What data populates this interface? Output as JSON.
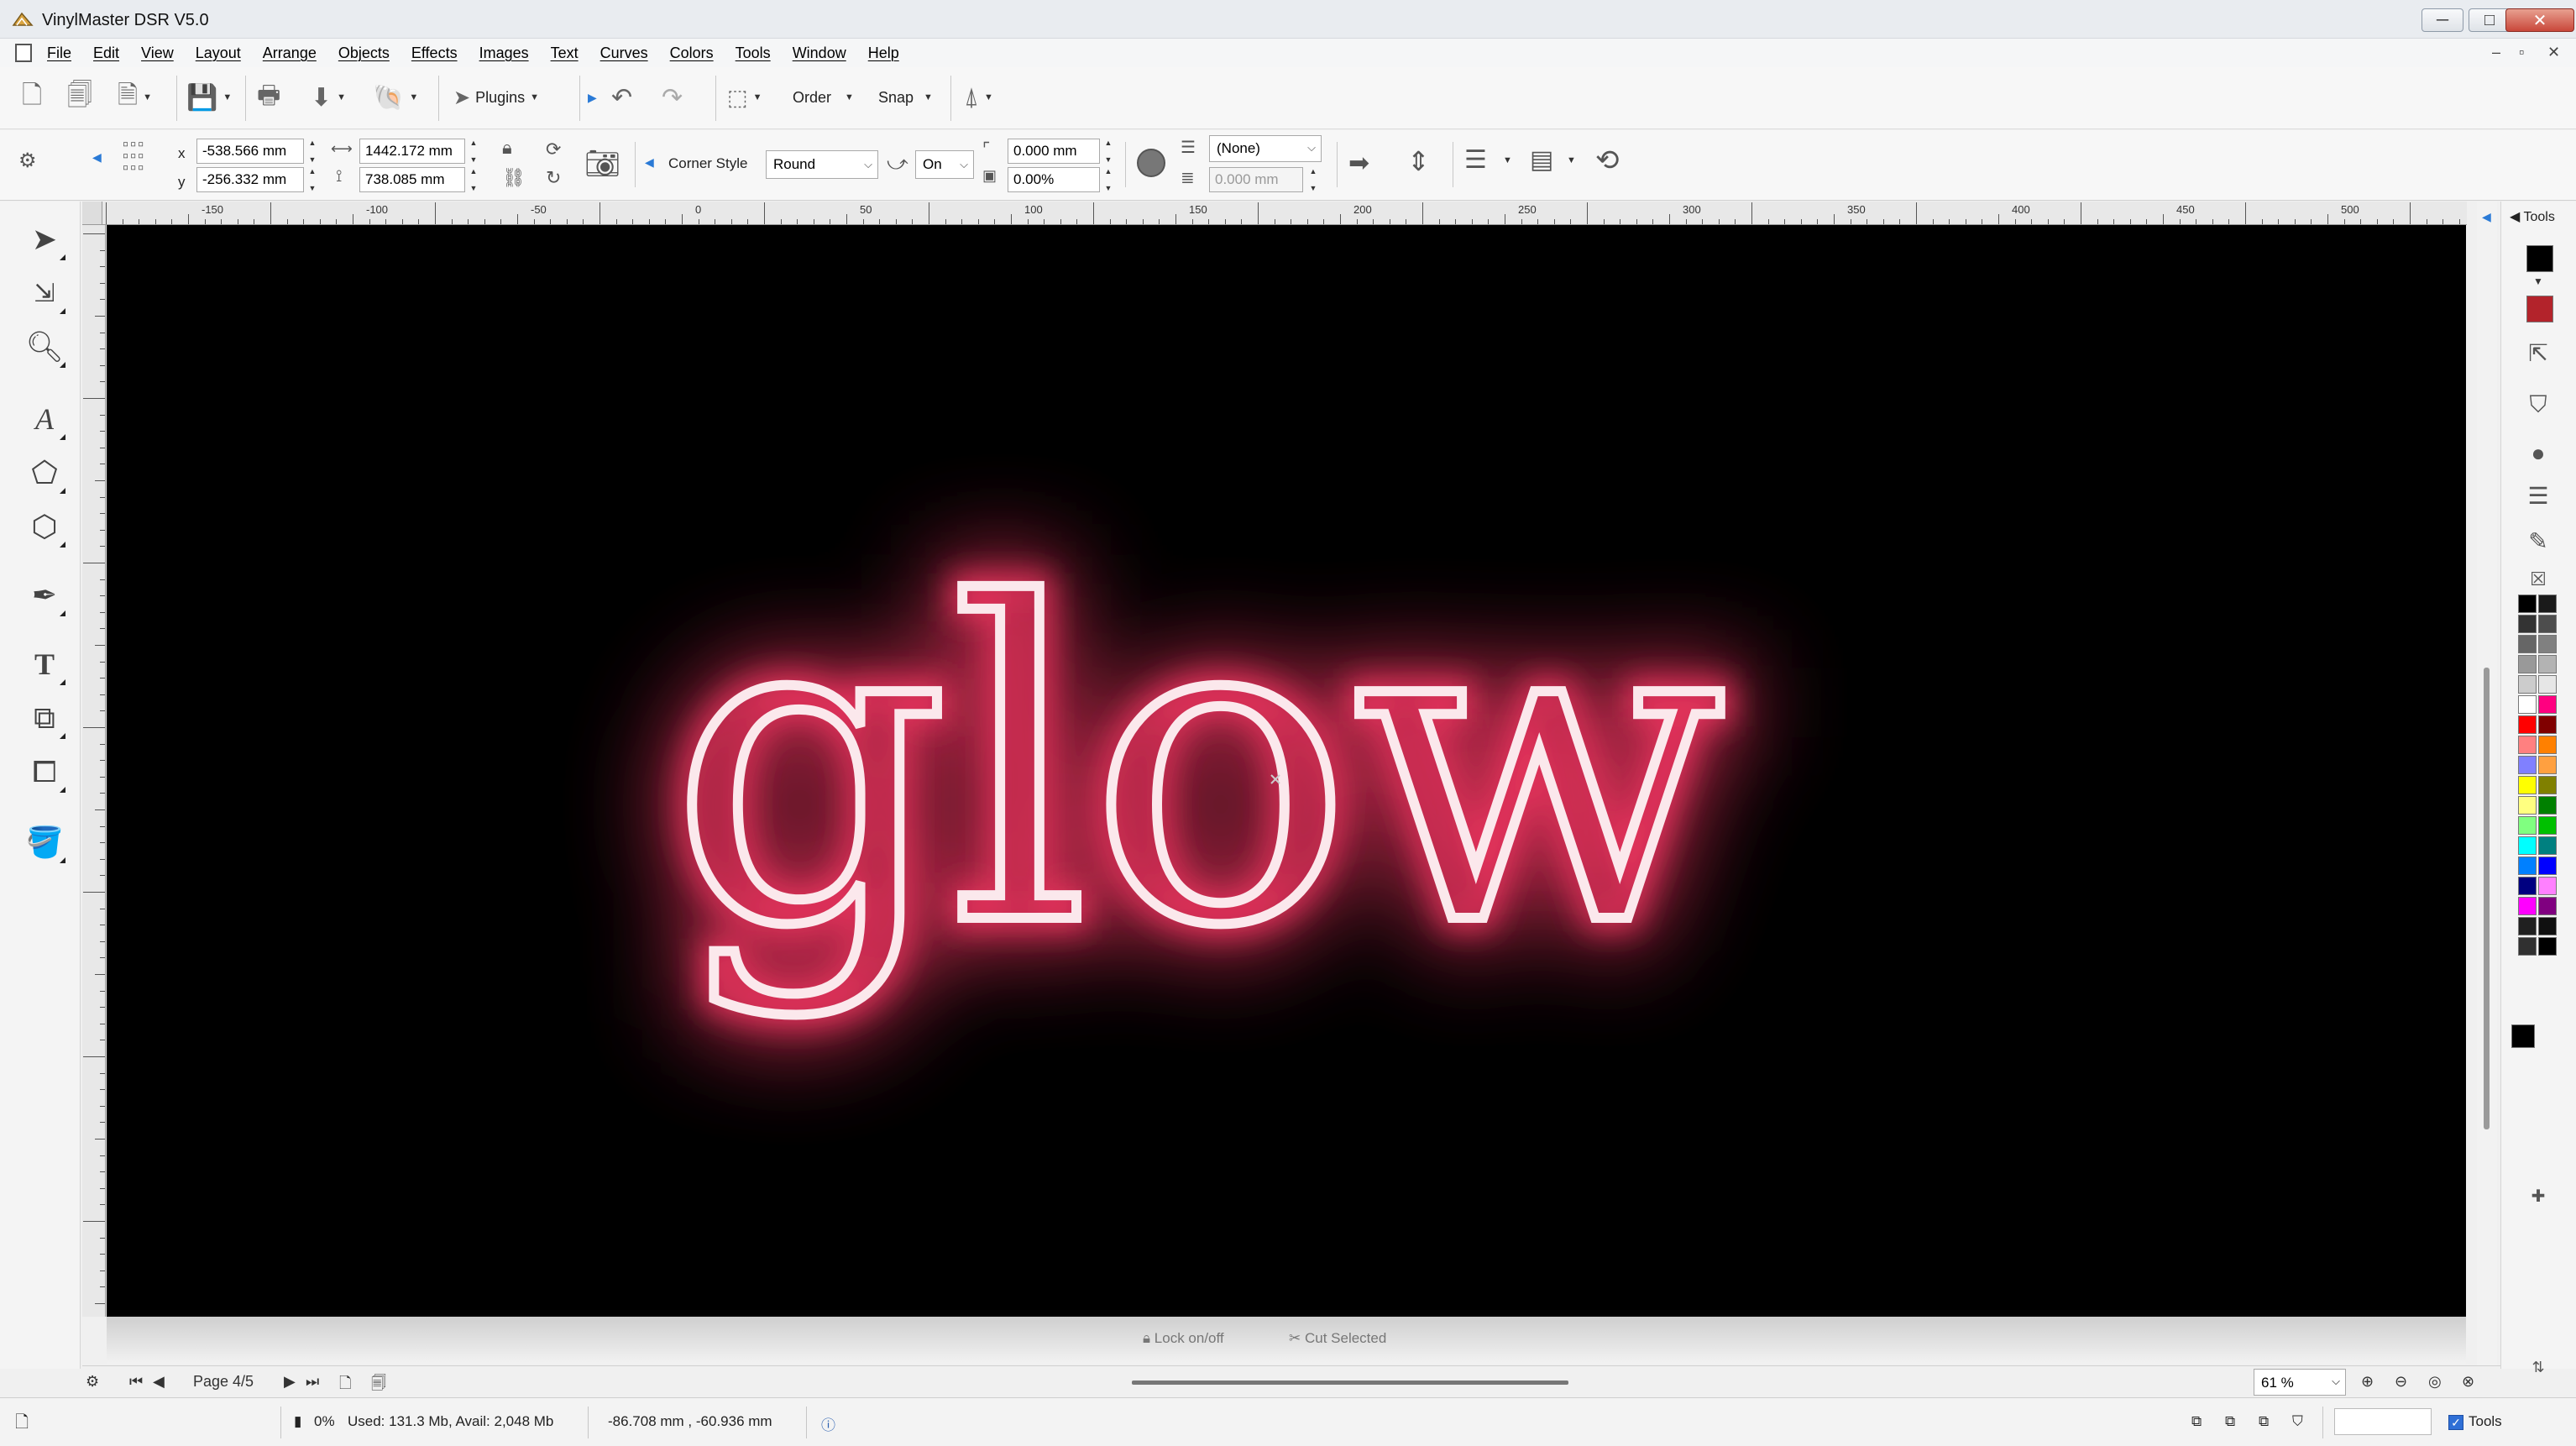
{
  "window": {
    "title": "VinylMaster DSR V5.0",
    "controls": {
      "minimize": "─",
      "maximize": "□",
      "close": "✕"
    }
  },
  "menubar": {
    "items": [
      "File",
      "Edit",
      "View",
      "Layout",
      "Arrange",
      "Objects",
      "Effects",
      "Images",
      "Text",
      "Curves",
      "Colors",
      "Tools",
      "Window",
      "Help"
    ],
    "mdi_controls": [
      "–",
      "▫",
      "✕"
    ]
  },
  "toolbar": {
    "plugins_label": "Plugins",
    "order_label": "Order",
    "snap_label": "Snap"
  },
  "propbar": {
    "x_label": "x",
    "y_label": "y",
    "x_value": "-538.566 mm",
    "y_value": "-256.332 mm",
    "width_value": "1442.172 mm",
    "height_value": "738.085 mm",
    "corner_style_label": "Corner Style",
    "corner_style_value": "Round",
    "corner_on_value": "On",
    "corner_radius_value": "0.000 mm",
    "corner_percent_value": "0.00%",
    "line_style_value": "(None)",
    "line_width_value": "0.000 mm"
  },
  "ruler": {
    "labels": [
      "-150",
      "-100",
      "-50",
      "0",
      "50",
      "100",
      "150",
      "200",
      "250",
      "300",
      "350",
      "400",
      "450",
      "500"
    ]
  },
  "canvas": {
    "artwork_text": "glow",
    "background_color": "#000000",
    "glow_color": "#e0335a",
    "stroke_color": "#fbe8ec",
    "lock_label": "Lock on/off",
    "cut_selected_label": "Cut Selected"
  },
  "right_dock": {
    "title": "Tools",
    "fill_color": "#000000",
    "outline_color": "#b3232b",
    "palette_colors": [
      "#000000",
      "#1a1a1a",
      "#333333",
      "#4d4d4d",
      "#666666",
      "#808080",
      "#999999",
      "#b3b3b3",
      "#cccccc",
      "#e6e6e6",
      "#ffffff",
      "#ff0080",
      "#ff0000",
      "#800000",
      "#ff8080",
      "#ff8000",
      "#8080ff",
      "#ffa040",
      "#ffff00",
      "#808000",
      "#ffff80",
      "#008000",
      "#80ff80",
      "#00c000",
      "#00ffff",
      "#008080",
      "#0080ff",
      "#0000ff",
      "#000080",
      "#ff80ff",
      "#ff00ff",
      "#800080",
      "#202020",
      "#101010",
      "#303030",
      "#000000"
    ]
  },
  "pagebar": {
    "page_label": "Page 4/5",
    "zoom_value": "61 %"
  },
  "statusbar": {
    "progress": "0%",
    "memory": "Used: 131.3 Mb, Avail: 2,048 Mb",
    "coordinates": "-86.708 mm , -60.936 mm",
    "tools_label": "Tools"
  }
}
